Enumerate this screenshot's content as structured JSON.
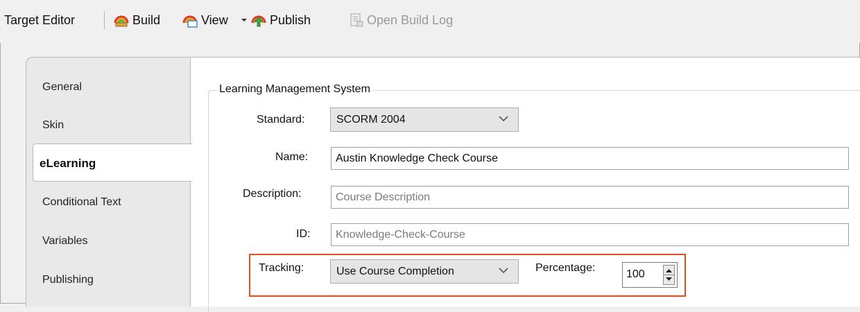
{
  "toolbar": {
    "title": "Target Editor",
    "build_label": "Build",
    "view_label": "View",
    "publish_label": "Publish",
    "open_build_log_label": "Open Build Log"
  },
  "tabs": [
    {
      "label": "General"
    },
    {
      "label": "Skin"
    },
    {
      "label": "eLearning",
      "active": true
    },
    {
      "label": "Conditional Text"
    },
    {
      "label": "Variables"
    },
    {
      "label": "Publishing"
    }
  ],
  "lms": {
    "group_title": "Learning Management System",
    "standard_label": "Standard:",
    "standard_value": "SCORM 2004",
    "name_label": "Name:",
    "name_value": "Austin Knowledge Check Course",
    "description_label": "Description:",
    "description_placeholder": "Course Description",
    "id_label": "ID:",
    "id_placeholder": "Knowledge-Check-Course",
    "tracking_label": "Tracking:",
    "tracking_value": "Use Course Completion",
    "percentage_label": "Percentage:",
    "percentage_value": "100"
  },
  "colors": {
    "highlight": "#e04d21",
    "panel": "#ffffff",
    "window": "#f0f0f0"
  }
}
